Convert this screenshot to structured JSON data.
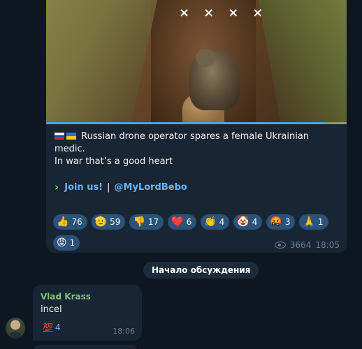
{
  "post": {
    "caption_flags": [
      "ru-flag",
      "ua-flag"
    ],
    "caption": "Russian drone operator spares a female Ukrainian medic.",
    "line2": "In war that’s a good heart",
    "join_link": "Join us!",
    "separator": "|",
    "channel_link": "@MyLordBebo",
    "video_marks": [
      "×",
      "×",
      "×",
      "×",
      "×"
    ],
    "video_progress_pct": 93,
    "reactions": [
      {
        "emoji": "👍",
        "count": "76"
      },
      {
        "emoji": "🫡",
        "count": "59"
      },
      {
        "emoji": "👎",
        "count": "17"
      },
      {
        "emoji": "❤️",
        "count": "6"
      },
      {
        "emoji": "👏",
        "count": "4"
      },
      {
        "emoji": "🤡",
        "count": "4"
      },
      {
        "emoji": "🤬",
        "count": "3"
      },
      {
        "emoji": "🙏",
        "count": "1"
      },
      {
        "emoji": "😡",
        "count": "1"
      }
    ],
    "views": "3664",
    "time": "18:05"
  },
  "service_message": "Начало обсуждения",
  "comment": {
    "author": "Vlad Krass",
    "text": "incel",
    "reaction": {
      "emoji": "💯",
      "count": "4"
    },
    "time": "18:06"
  },
  "colors": {
    "background": "#0e1621",
    "bubble": "#182533",
    "link": "#6ab3f3",
    "author": "#7fc27a",
    "reaction_bg": "#2b5278"
  }
}
